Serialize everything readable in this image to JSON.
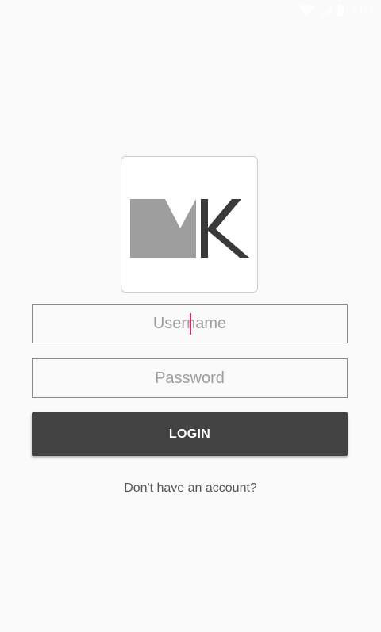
{
  "status_bar": {
    "time": "4:03",
    "icons": [
      "wifi-icon",
      "cell-signal-icon",
      "battery-icon"
    ]
  },
  "logo": {
    "text": "MK",
    "colors": {
      "m": "#9e9e9e",
      "k": "#3a3a3a"
    }
  },
  "form": {
    "username_placeholder": "Username",
    "password_placeholder": "Password",
    "login_label": "LOGIN",
    "signup_link": "Don't have an account?"
  },
  "colors": {
    "background": "#fafafa",
    "button": "#424242",
    "cursor": "#e91e63"
  }
}
